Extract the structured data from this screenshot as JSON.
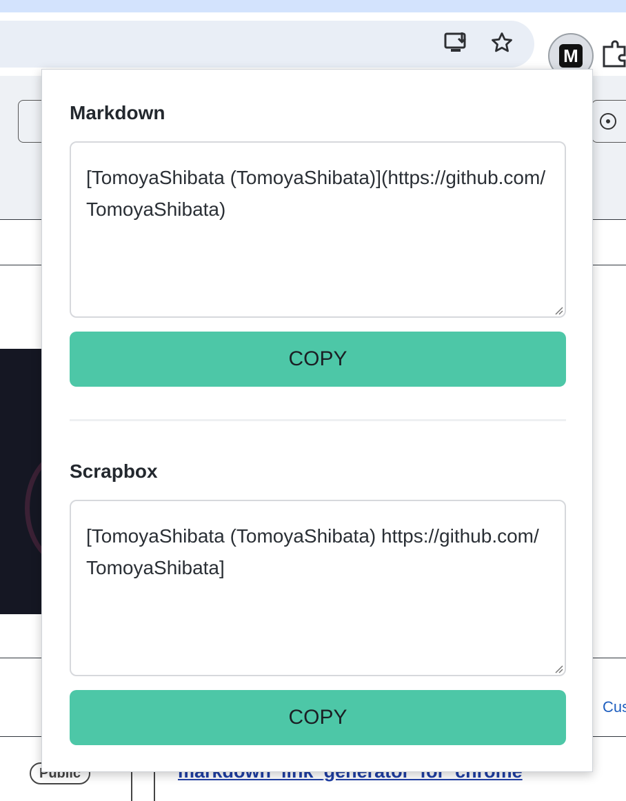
{
  "browser": {
    "extension_label": "M",
    "icons": [
      "install-app-icon",
      "bookmark-star-icon",
      "extension-m-icon",
      "extensions-puzzle-icon"
    ]
  },
  "background_page": {
    "side_link_text": "Cus",
    "visibility_badge": "Public",
    "repo_link_text": "markdown_link_generator_for_chrome"
  },
  "popup": {
    "sections": [
      {
        "title": "Markdown",
        "text": "[TomoyaShibata (TomoyaShibata)](https://github.com/TomoyaShibata)",
        "button_label": "COPY"
      },
      {
        "title": "Scrapbox",
        "text": "[TomoyaShibata (TomoyaShibata) https://github.com/TomoyaShibata]",
        "button_label": "COPY"
      }
    ]
  },
  "colors": {
    "accent_button": "#4dc7a7",
    "tabstrip": "#d3e3fd",
    "omnibox": "#e9eef6"
  }
}
